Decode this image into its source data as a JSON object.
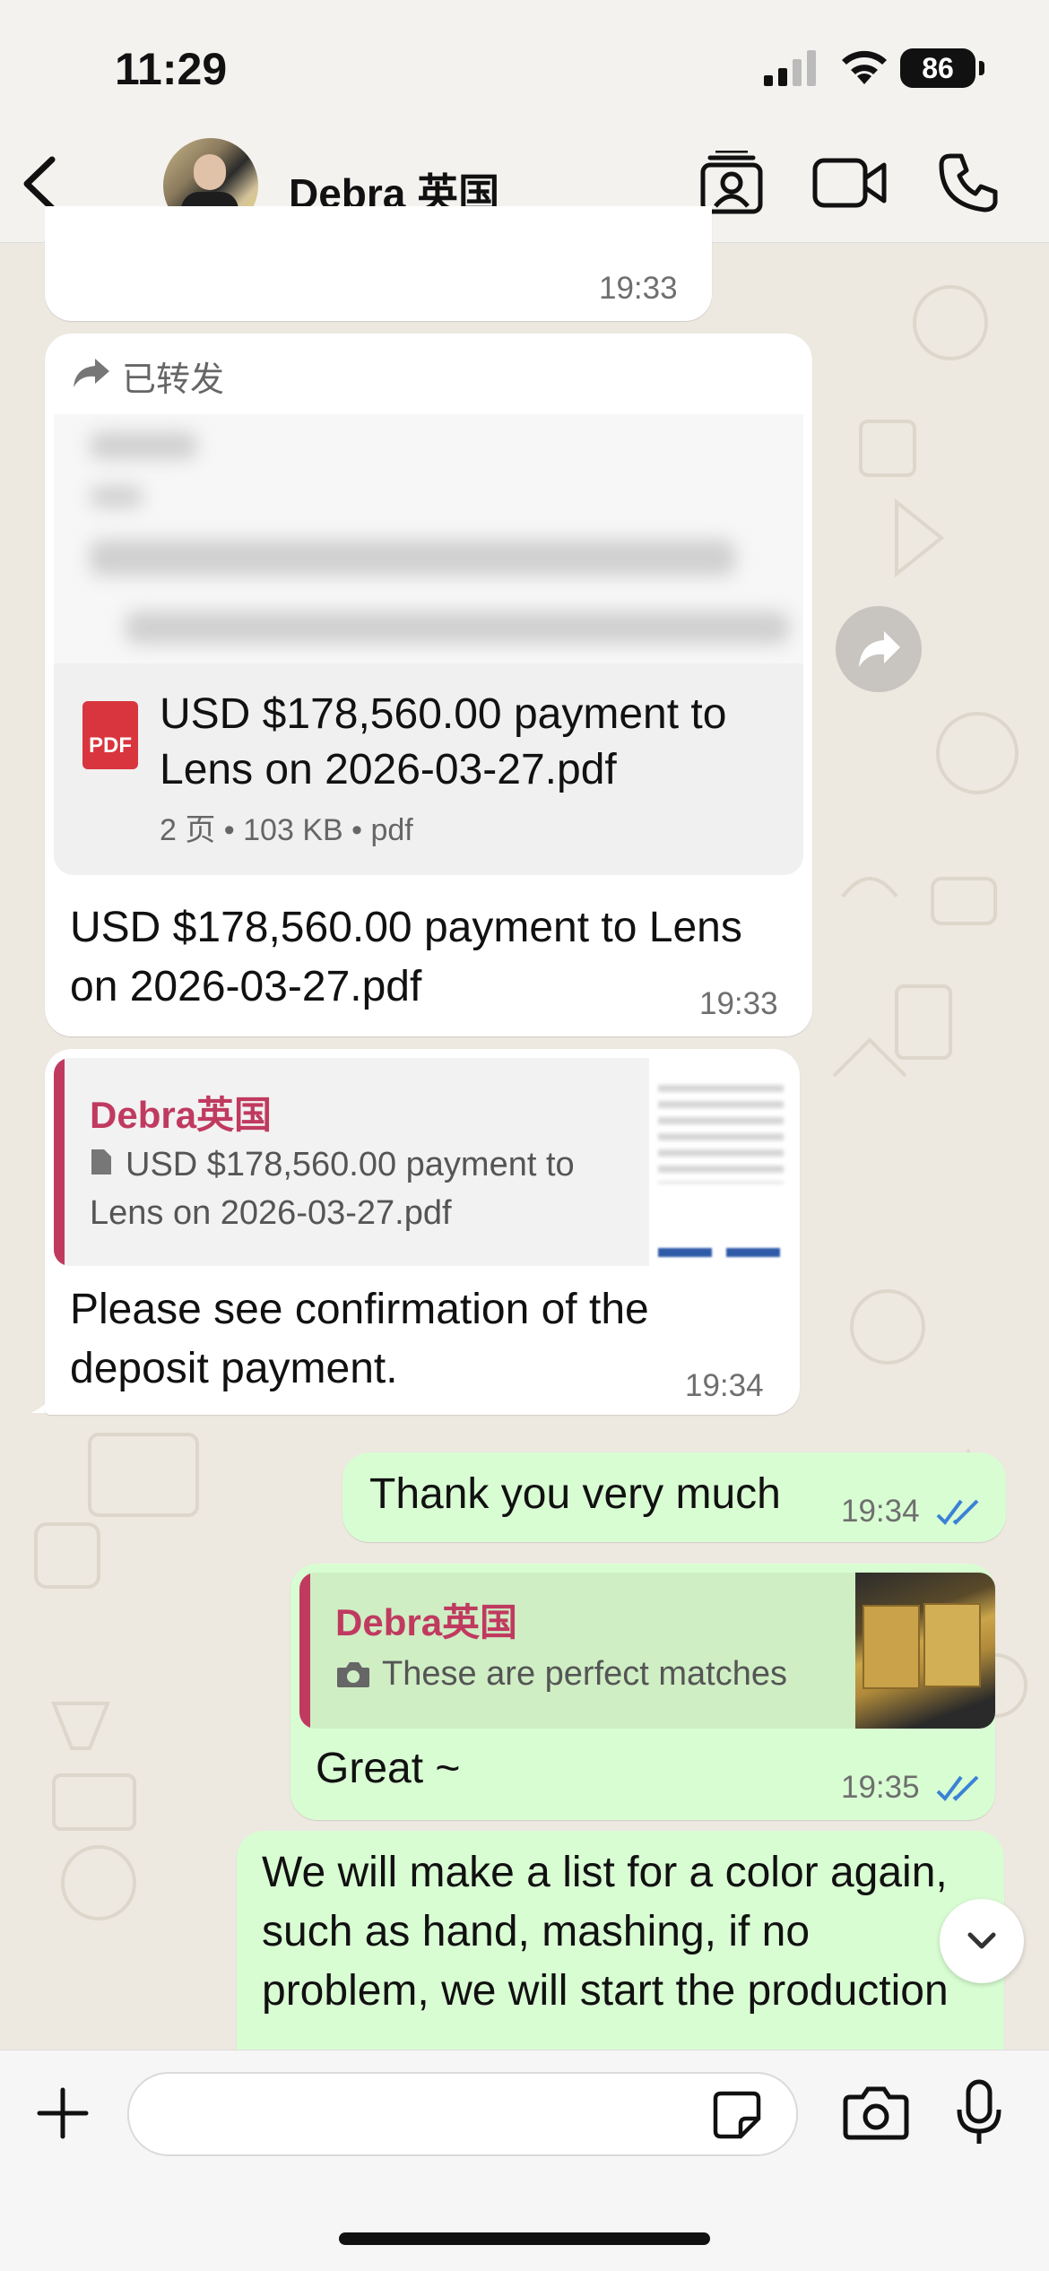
{
  "status_bar": {
    "time": "11:29",
    "battery": "86"
  },
  "header": {
    "contact_name": "Debra 英国"
  },
  "messages": {
    "m0": {
      "time": "19:33"
    },
    "m1": {
      "forwarded_label": "已转发",
      "file_name": "USD $178,560.00 payment to Lens on 2026-03-27.pdf",
      "file_type_badge": "PDF",
      "file_meta": "2 页 • 103 KB • pdf",
      "caption": "USD $178,560.00 payment to Lens on 2026-03-27.pdf",
      "time": "19:33"
    },
    "m2": {
      "quote_name": "Debra英国",
      "quote_text": "USD $178,560.00 payment to Lens on 2026-03-27.pdf",
      "text": "Please see confirmation of the deposit payment.",
      "time": "19:34"
    },
    "m3": {
      "text": "Thank you very much",
      "time": "19:34"
    },
    "m4": {
      "quote_name": "Debra英国",
      "quote_text": "These are perfect matches",
      "text": "Great ~",
      "time": "19:35"
    },
    "m5": {
      "text": "We will make a list for a color again, such as hand, mashing, if no problem, we will start the production"
    }
  },
  "colors": {
    "outgoing_bubble": "#d9fdd3",
    "quote_accent": "#c03a60",
    "read_ticks": "#3b82d6"
  }
}
